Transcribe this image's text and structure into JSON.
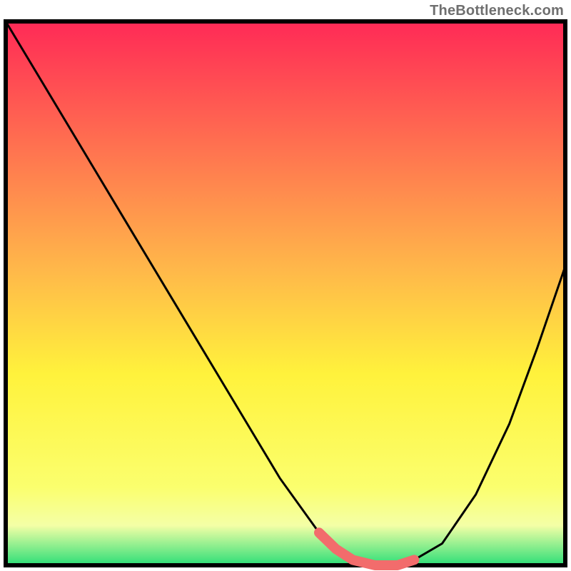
{
  "attribution": "TheBottleneck.com",
  "colors": {
    "border": "#000000",
    "line": "#000000",
    "highlight_stroke": "#f26c6c",
    "gradient_top": "#ff2b56",
    "gradient_mid_upper": "#ffb64a",
    "gradient_mid": "#fff23c",
    "gradient_lower": "#fbff6e",
    "gradient_band": "#f4ffa6",
    "gradient_bottom": "#37e07a"
  },
  "chart_data": {
    "type": "line",
    "title": "",
    "xlabel": "",
    "ylabel": "",
    "xlim": [
      0,
      100
    ],
    "ylim": [
      0,
      100
    ],
    "grid": false,
    "legend": false,
    "series": [
      {
        "name": "bottleneck-curve",
        "x": [
          0,
          7,
          14,
          21,
          28,
          35,
          42,
          49,
          56,
          59,
          62,
          66,
          70,
          73,
          78,
          84,
          90,
          95,
          100
        ],
        "y": [
          100,
          88,
          76,
          64,
          52,
          40,
          28,
          16,
          6,
          3,
          1,
          0,
          0,
          1,
          4,
          13,
          26,
          40,
          55
        ]
      }
    ],
    "highlight": {
      "name": "flat-minimum",
      "x_range": [
        56,
        74
      ],
      "y_range": [
        0,
        3
      ]
    },
    "background_gradient": {
      "direction": "vertical",
      "stops": [
        {
          "y": 100,
          "color": "#ff2b56"
        },
        {
          "y": 55,
          "color": "#ffb64a"
        },
        {
          "y": 35,
          "color": "#fff23c"
        },
        {
          "y": 14,
          "color": "#fbff6e"
        },
        {
          "y": 7,
          "color": "#f4ffa6"
        },
        {
          "y": 0,
          "color": "#37e07a"
        }
      ]
    }
  }
}
